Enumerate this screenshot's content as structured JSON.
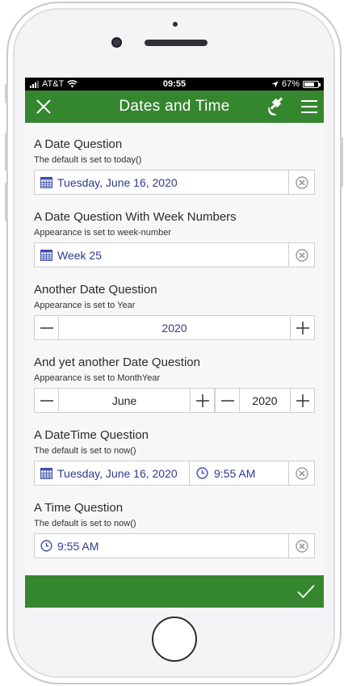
{
  "status_bar": {
    "carrier": "AT&T",
    "time": "09:55",
    "battery": "67%"
  },
  "header": {
    "title": "Dates and Time"
  },
  "questions": [
    {
      "label": "A Date Question",
      "hint": "The default is set to today()",
      "value": "Tuesday, June 16, 2020"
    },
    {
      "label": "A Date Question With Week Numbers",
      "hint": "Appearance is set to week-number",
      "value": "Week 25"
    },
    {
      "label": "Another Date Question",
      "hint": "Appearance is set to Year",
      "value": "2020"
    },
    {
      "label": "And yet another Date Question",
      "hint": "Appearance is set to MonthYear",
      "month": "June",
      "year": "2020"
    },
    {
      "label": "A DateTime Question",
      "hint": "The default is set to now()",
      "date": "Tuesday, June 16, 2020",
      "time": "9:55 AM"
    },
    {
      "label": "A Time Question",
      "hint": "The default is set to now()",
      "value": "9:55 AM"
    }
  ],
  "colors": {
    "brand_green": "#34862f",
    "value_text": "#2c3b8f",
    "icon_blue": "#3d4fa8"
  },
  "icons": [
    "close-icon",
    "gps-icon",
    "menu-icon",
    "calendar-icon",
    "clock-icon",
    "clear-icon",
    "minus-icon",
    "plus-icon",
    "check-icon"
  ]
}
